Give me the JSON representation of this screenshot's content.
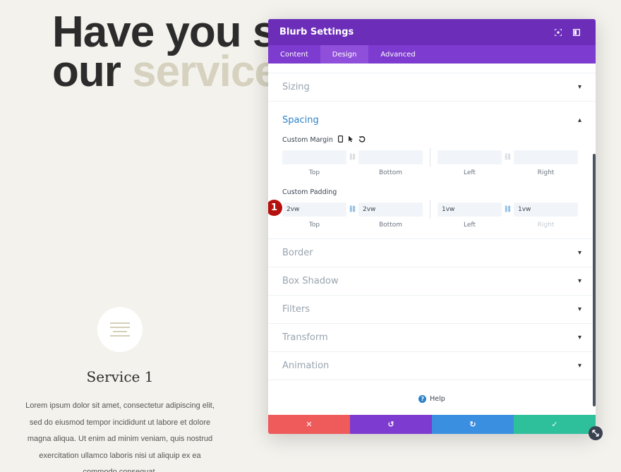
{
  "page": {
    "hero_line1": "Have you s",
    "hero_line2_a": "our ",
    "hero_line2_b": "service",
    "service_title": "Service 1",
    "service_text": "Lorem ipsum dolor sit amet, consectetur adipiscing elit, sed do eiusmod tempor incididunt ut labore et dolore magna aliqua. Ut enim ad minim veniam, quis nostrud exercitation ullamco laboris nisi ut aliquip ex ea commodo consequat."
  },
  "modal": {
    "title": "Blurb Settings",
    "tabs": [
      {
        "label": "Content",
        "active": false
      },
      {
        "label": "Design",
        "active": true
      },
      {
        "label": "Advanced",
        "active": false
      }
    ],
    "sections_above": [
      {
        "label": "Sizing"
      }
    ],
    "spacing": {
      "label": "Spacing",
      "margin": {
        "label": "Custom Margin",
        "top": "",
        "bottom": "",
        "left": "",
        "right": ""
      },
      "padding": {
        "label": "Custom Padding",
        "top": "2vw",
        "bottom": "2vw",
        "left": "1vw",
        "right": "1vw"
      },
      "side_labels": {
        "top": "Top",
        "bottom": "Bottom",
        "left": "Left",
        "right": "Right"
      },
      "badge": "1"
    },
    "sections_below": [
      {
        "label": "Border"
      },
      {
        "label": "Box Shadow"
      },
      {
        "label": "Filters"
      },
      {
        "label": "Transform"
      },
      {
        "label": "Animation"
      }
    ],
    "help_label": "Help",
    "footer": {
      "cancel": "✕",
      "undo": "↺",
      "redo": "↻",
      "save": "✓"
    }
  },
  "icons": {
    "fullscreen": "fullscreen-icon",
    "sidebar": "sidebar-icon",
    "chevron_down": "▾",
    "chevron_up": "▴"
  },
  "colors": {
    "header": "#6c2eb9",
    "tabs": "#7d3bcf",
    "accent_blue": "#2c82c9",
    "cancel": "#ef5a5a",
    "undo": "#7d3bcf",
    "redo": "#3b8fe0",
    "save": "#2ebf9b",
    "badge": "#b5120f"
  }
}
